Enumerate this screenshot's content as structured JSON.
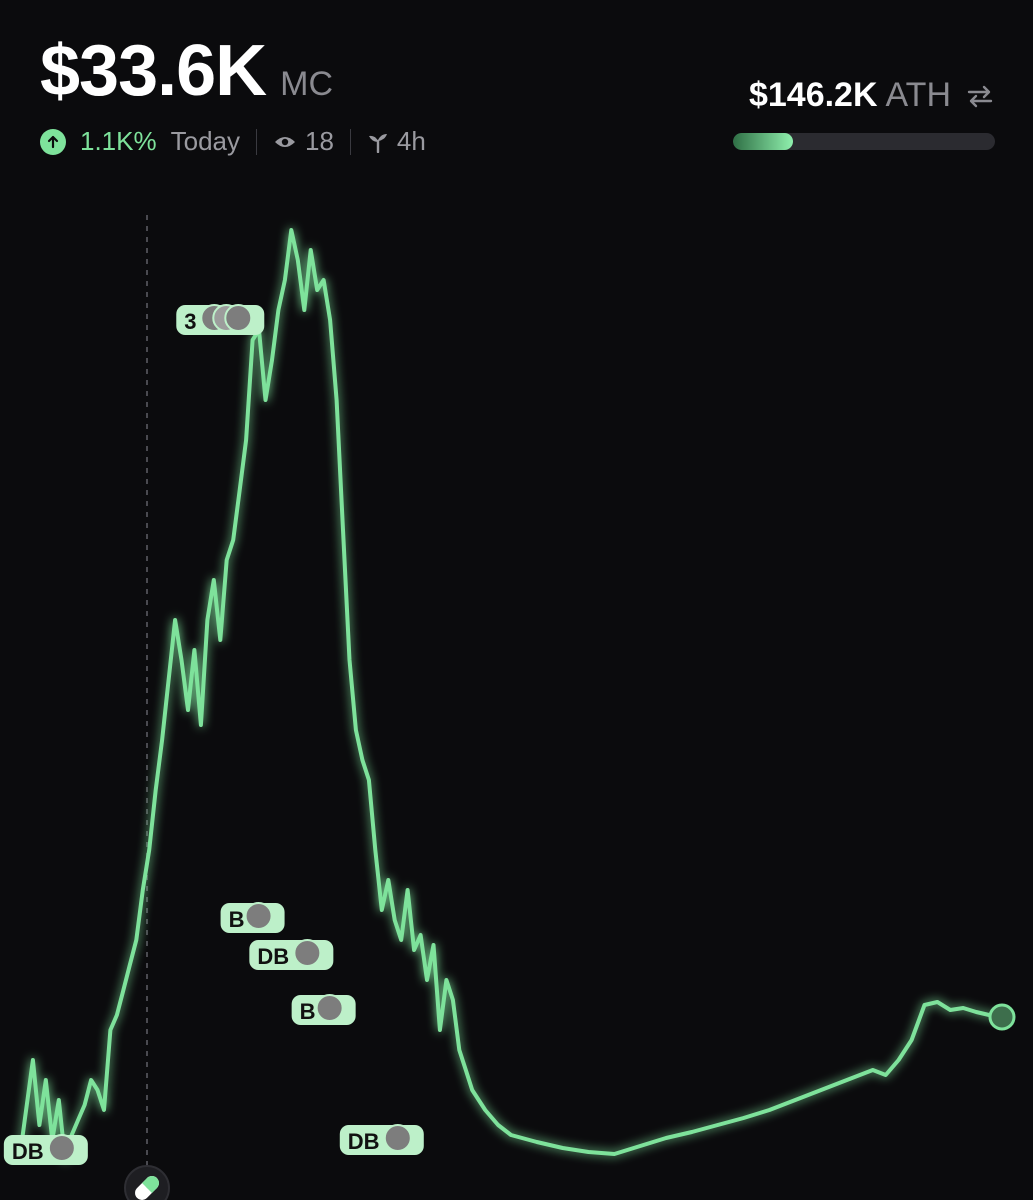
{
  "header": {
    "market_cap": "$33.6K",
    "market_cap_label": "MC",
    "change_pct": "1.1K%",
    "change_period": "Today",
    "views": "18",
    "age": "4h",
    "ath_value": "$146.2K",
    "ath_label": "ATH",
    "ath_progress_pct": 23
  },
  "colors": {
    "accent_green": "#7ee29b",
    "background": "#0b0b0d",
    "muted": "#8a8a90"
  },
  "icons": {
    "change": "arrow-up-circle-icon",
    "views": "eye-icon",
    "age": "sprout-icon",
    "ath_toggle": "swap-arrows-icon",
    "tool": "pill-icon"
  },
  "chart_data": {
    "type": "line",
    "y_unit": "market cap (USD)",
    "grid": false,
    "series_points": [
      [
        0,
        25
      ],
      [
        2,
        120
      ],
      [
        3,
        55
      ],
      [
        4,
        100
      ],
      [
        5,
        40
      ],
      [
        6,
        80
      ],
      [
        7,
        20
      ],
      [
        8,
        45
      ],
      [
        9,
        60
      ],
      [
        10,
        75
      ],
      [
        11,
        100
      ],
      [
        12,
        90
      ],
      [
        13,
        70
      ],
      [
        14,
        150
      ],
      [
        15,
        165
      ],
      [
        16,
        190
      ],
      [
        17,
        215
      ],
      [
        18,
        240
      ],
      [
        19,
        290
      ],
      [
        20,
        330
      ],
      [
        21,
        390
      ],
      [
        22,
        440
      ],
      [
        23,
        500
      ],
      [
        24,
        560
      ],
      [
        25,
        520
      ],
      [
        26,
        470
      ],
      [
        27,
        530
      ],
      [
        28,
        455
      ],
      [
        29,
        560
      ],
      [
        30,
        600
      ],
      [
        31,
        540
      ],
      [
        32,
        620
      ],
      [
        33,
        640
      ],
      [
        34,
        690
      ],
      [
        35,
        740
      ],
      [
        36,
        840
      ],
      [
        37,
        850
      ],
      [
        38,
        780
      ],
      [
        39,
        820
      ],
      [
        40,
        870
      ],
      [
        41,
        900
      ],
      [
        42,
        950
      ],
      [
        43,
        920
      ],
      [
        44,
        870
      ],
      [
        45,
        930
      ],
      [
        46,
        890
      ],
      [
        47,
        900
      ],
      [
        48,
        860
      ],
      [
        49,
        780
      ],
      [
        50,
        650
      ],
      [
        51,
        520
      ],
      [
        52,
        450
      ],
      [
        53,
        420
      ],
      [
        54,
        400
      ],
      [
        55,
        330
      ],
      [
        56,
        270
      ],
      [
        57,
        300
      ],
      [
        58,
        260
      ],
      [
        59,
        240
      ],
      [
        60,
        290
      ],
      [
        61,
        230
      ],
      [
        62,
        245
      ],
      [
        63,
        200
      ],
      [
        64,
        235
      ],
      [
        65,
        150
      ],
      [
        66,
        200
      ],
      [
        67,
        180
      ],
      [
        68,
        130
      ],
      [
        69,
        110
      ],
      [
        70,
        90
      ],
      [
        72,
        70
      ],
      [
        74,
        55
      ],
      [
        76,
        45
      ],
      [
        80,
        38
      ],
      [
        84,
        32
      ],
      [
        88,
        28
      ],
      [
        92,
        26
      ],
      [
        96,
        34
      ],
      [
        100,
        42
      ],
      [
        104,
        48
      ],
      [
        108,
        55
      ],
      [
        112,
        62
      ],
      [
        116,
        70
      ],
      [
        120,
        80
      ],
      [
        124,
        90
      ],
      [
        128,
        100
      ],
      [
        132,
        110
      ],
      [
        134,
        105
      ],
      [
        136,
        120
      ],
      [
        138,
        140
      ],
      [
        140,
        175
      ],
      [
        142,
        178
      ],
      [
        144,
        170
      ],
      [
        146,
        172
      ],
      [
        148,
        168
      ],
      [
        150,
        165
      ],
      [
        152,
        163
      ]
    ],
    "event_markers": [
      {
        "label": "DB",
        "avatars": 1
      },
      {
        "label": "3",
        "avatars": 3
      },
      {
        "label": "B",
        "avatars": 1
      },
      {
        "label": "DB",
        "avatars": 1
      },
      {
        "label": "B",
        "avatars": 1
      },
      {
        "label": "DB",
        "avatars": 1
      }
    ]
  }
}
